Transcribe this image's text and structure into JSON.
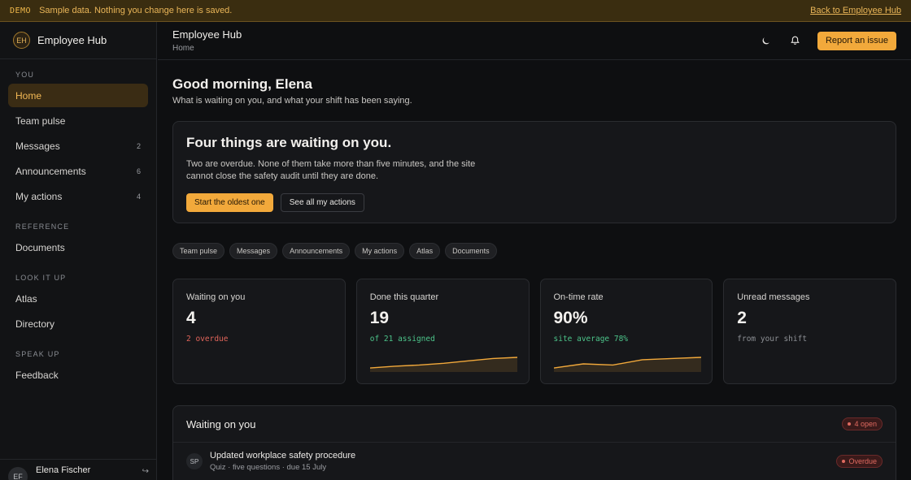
{
  "banner": {
    "tag": "DEMO",
    "message": "Sample data. Nothing you change here is saved.",
    "back_link": "Back to Employee Hub"
  },
  "brand": {
    "initials": "EH",
    "name": "Employee Hub"
  },
  "sidebar": {
    "sections": [
      {
        "label": "YOU",
        "items": [
          {
            "label": "Home",
            "count": "",
            "active": true
          },
          {
            "label": "Team pulse",
            "count": ""
          },
          {
            "label": "Messages",
            "count": "2"
          },
          {
            "label": "Announcements",
            "count": "6"
          },
          {
            "label": "My actions",
            "count": "4"
          }
        ]
      },
      {
        "label": "REFERENCE",
        "items": [
          {
            "label": "Documents",
            "count": ""
          }
        ]
      },
      {
        "label": "LOOK IT UP",
        "items": [
          {
            "label": "Atlas",
            "count": ""
          },
          {
            "label": "Directory",
            "count": ""
          }
        ]
      },
      {
        "label": "SPEAK UP",
        "items": [
          {
            "label": "Feedback",
            "count": ""
          }
        ]
      }
    ]
  },
  "user": {
    "initials": "EF",
    "name": "Elena Fischer"
  },
  "topbar": {
    "title": "Employee Hub",
    "breadcrumb": "Home",
    "report_label": "Report an issue",
    "theme_icon": "moon-icon",
    "bell_icon": "bell-icon"
  },
  "greeting": {
    "title": "Good morning, Elena",
    "subtitle": "What is waiting on you, and what your shift has been saying."
  },
  "hero": {
    "title": "Four things are waiting on you.",
    "body": "Two are overdue. None of them take more than five minutes, and the site cannot close the safety audit until they are done.",
    "primary_label": "Start the oldest one",
    "secondary_label": "See all my actions"
  },
  "chips": [
    "Team pulse",
    "Messages",
    "Announcements",
    "My actions",
    "Atlas",
    "Documents"
  ],
  "stats": [
    {
      "label": "Waiting on you",
      "value": "4",
      "note": "2 overdue",
      "tone": "red",
      "trend": []
    },
    {
      "label": "Done this quarter",
      "value": "19",
      "note": "of 21 assigned",
      "tone": "green",
      "trend": [
        2,
        3.5,
        4.5,
        6,
        8,
        10,
        11
      ]
    },
    {
      "label": "On-time rate",
      "value": "90%",
      "note": "site average 78%",
      "tone": "green",
      "trend": [
        2,
        5.5,
        4.5,
        9,
        10,
        11
      ]
    },
    {
      "label": "Unread messages",
      "value": "2",
      "note": "from your shift",
      "tone": "grey",
      "trend": []
    }
  ],
  "queue": {
    "title": "Waiting on you",
    "badge": "4 open",
    "items": [
      {
        "initials": "SP",
        "title": "Updated workplace safety procedure",
        "sub": "Quiz · five questions · due 15 July",
        "status": "Overdue"
      }
    ]
  },
  "colors": {
    "accent": "#f2a93b",
    "danger": "#e06a60",
    "success": "#4cc48a"
  }
}
